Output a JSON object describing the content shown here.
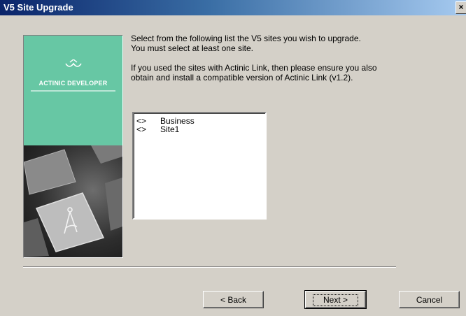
{
  "window": {
    "title": "V5 Site Upgrade",
    "close_glyph": "×"
  },
  "banner": {
    "brand": "ACTINIC DEVELOPER",
    "logo_icon": "actinic-logo-icon",
    "artwork": "keyboard-compass-key-image"
  },
  "instructions": {
    "line1": "Select from the following list the V5 sites you wish to upgrade.",
    "line2": "You must select at least one site.",
    "line3": "If you used the sites with Actinic Link, then please ensure you also",
    "line4": "obtain and install a compatible version of Actinic Link (v1.2)."
  },
  "site_list": {
    "items": [
      {
        "marker": "<>",
        "label": "Business"
      },
      {
        "marker": "<>",
        "label": "Site1"
      }
    ]
  },
  "buttons": {
    "back": "< Back",
    "next": "Next >",
    "cancel": "Cancel"
  }
}
